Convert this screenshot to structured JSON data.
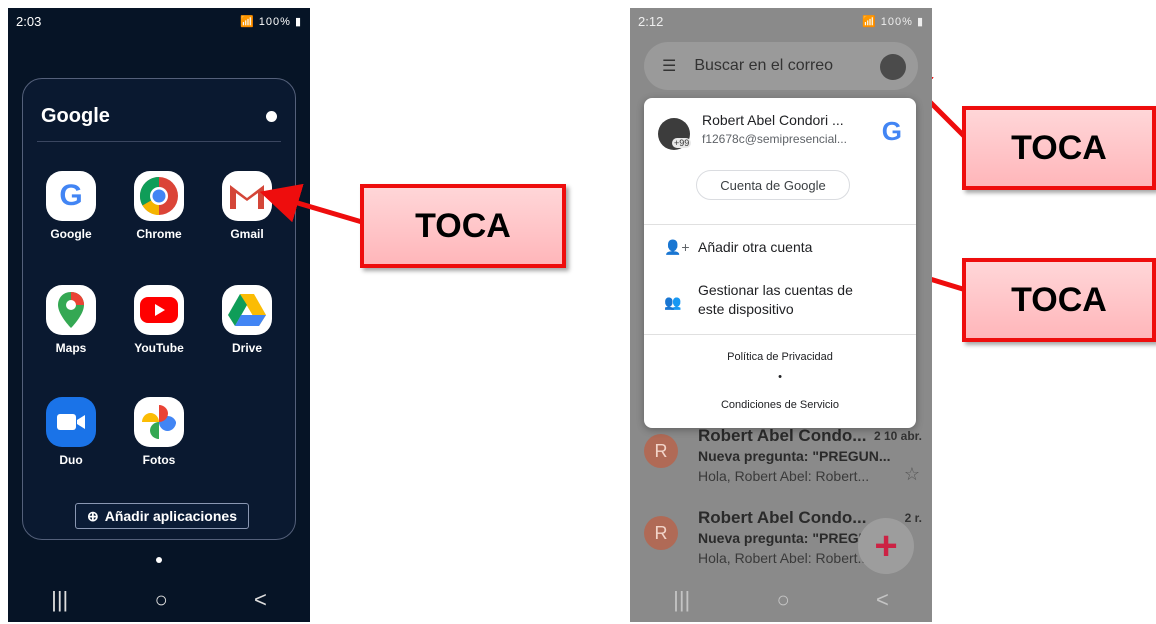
{
  "left_phone": {
    "status_time": "2:03",
    "status_right": "100%",
    "folder_title": "Google",
    "apps": [
      {
        "label": "Google",
        "icon": "google-icon"
      },
      {
        "label": "Chrome",
        "icon": "chrome-icon"
      },
      {
        "label": "Gmail",
        "icon": "gmail-icon"
      },
      {
        "label": "Maps",
        "icon": "maps-icon"
      },
      {
        "label": "YouTube",
        "icon": "youtube-icon"
      },
      {
        "label": "Drive",
        "icon": "drive-icon"
      },
      {
        "label": "Duo",
        "icon": "duo-icon"
      },
      {
        "label": "Fotos",
        "icon": "photos-icon"
      }
    ],
    "add_apps_label": "Añadir aplicaciones",
    "nav": [
      "|||",
      "○",
      "<"
    ]
  },
  "callouts": [
    "TOCA",
    "TOCA",
    "TOCA"
  ],
  "right_phone": {
    "status_time": "2:12",
    "status_right": "100%",
    "search_placeholder": "Buscar en el correo",
    "account": {
      "name": "Robert Abel Condori ...",
      "email": "f12678c@semipresencial...",
      "badge": "+99",
      "manage_label": "Cuenta de Google",
      "add_account": "Añadir otra cuenta",
      "manage_device_line1": "Gestionar las cuentas de",
      "manage_device_line2": "este dispositivo",
      "privacy": "Política de Privacidad",
      "dot": "•",
      "terms": "Condiciones de Servicio"
    },
    "mails": [
      {
        "avatar": "R",
        "from": "Robert Abel Condo...",
        "date": "2  10 abr.",
        "subject": "Nueva pregunta: \"PREGUN...",
        "snippet": "Hola, Robert Abel: Robert..."
      },
      {
        "avatar": "R",
        "from": "Robert Abel Condo...",
        "date": "2     r.",
        "subject": "Nueva pregunta: \"PREGU",
        "snippet": "Hola, Robert Abel: Robert..."
      }
    ],
    "nav": [
      "|||",
      "○",
      "<"
    ]
  },
  "colors": {
    "accent_red": "#ee0d0d",
    "callout_fill": "#ffc4c7"
  }
}
